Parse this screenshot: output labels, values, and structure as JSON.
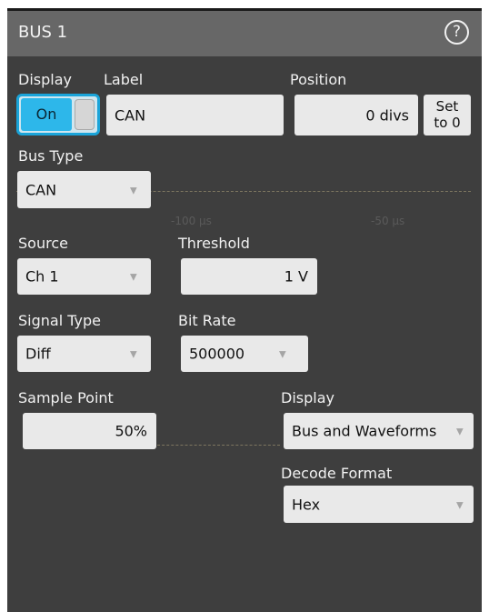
{
  "panel": {
    "title": "BUS 1"
  },
  "display_toggle": {
    "label": "Display",
    "state": "On"
  },
  "label_field": {
    "label": "Label",
    "value": "CAN"
  },
  "position_field": {
    "label": "Position",
    "value": "0 divs",
    "set_button": "Set\nto 0"
  },
  "bus_type": {
    "label": "Bus Type",
    "value": "CAN"
  },
  "source": {
    "label": "Source",
    "value": "Ch 1"
  },
  "threshold": {
    "label": "Threshold",
    "value": "1 V"
  },
  "signal_type": {
    "label": "Signal Type",
    "value": "Diff"
  },
  "bit_rate": {
    "label": "Bit Rate",
    "value": "500000"
  },
  "sample_point": {
    "label": "Sample Point",
    "value": "50%"
  },
  "bus_display": {
    "label": "Display",
    "value": "Bus and Waveforms"
  },
  "decode_format": {
    "label": "Decode Format",
    "value": "Hex"
  },
  "background_ticks": [
    "-100 µs",
    "-50 µs"
  ],
  "colors": {
    "panel_bg": "#3e3e3e",
    "titlebar_bg": "#676767",
    "toggle_accent": "#2db7ea",
    "field_bg": "#e9e9e9"
  },
  "icons": {
    "help": "question-circle-icon",
    "dropdown": "caret-down-icon"
  }
}
